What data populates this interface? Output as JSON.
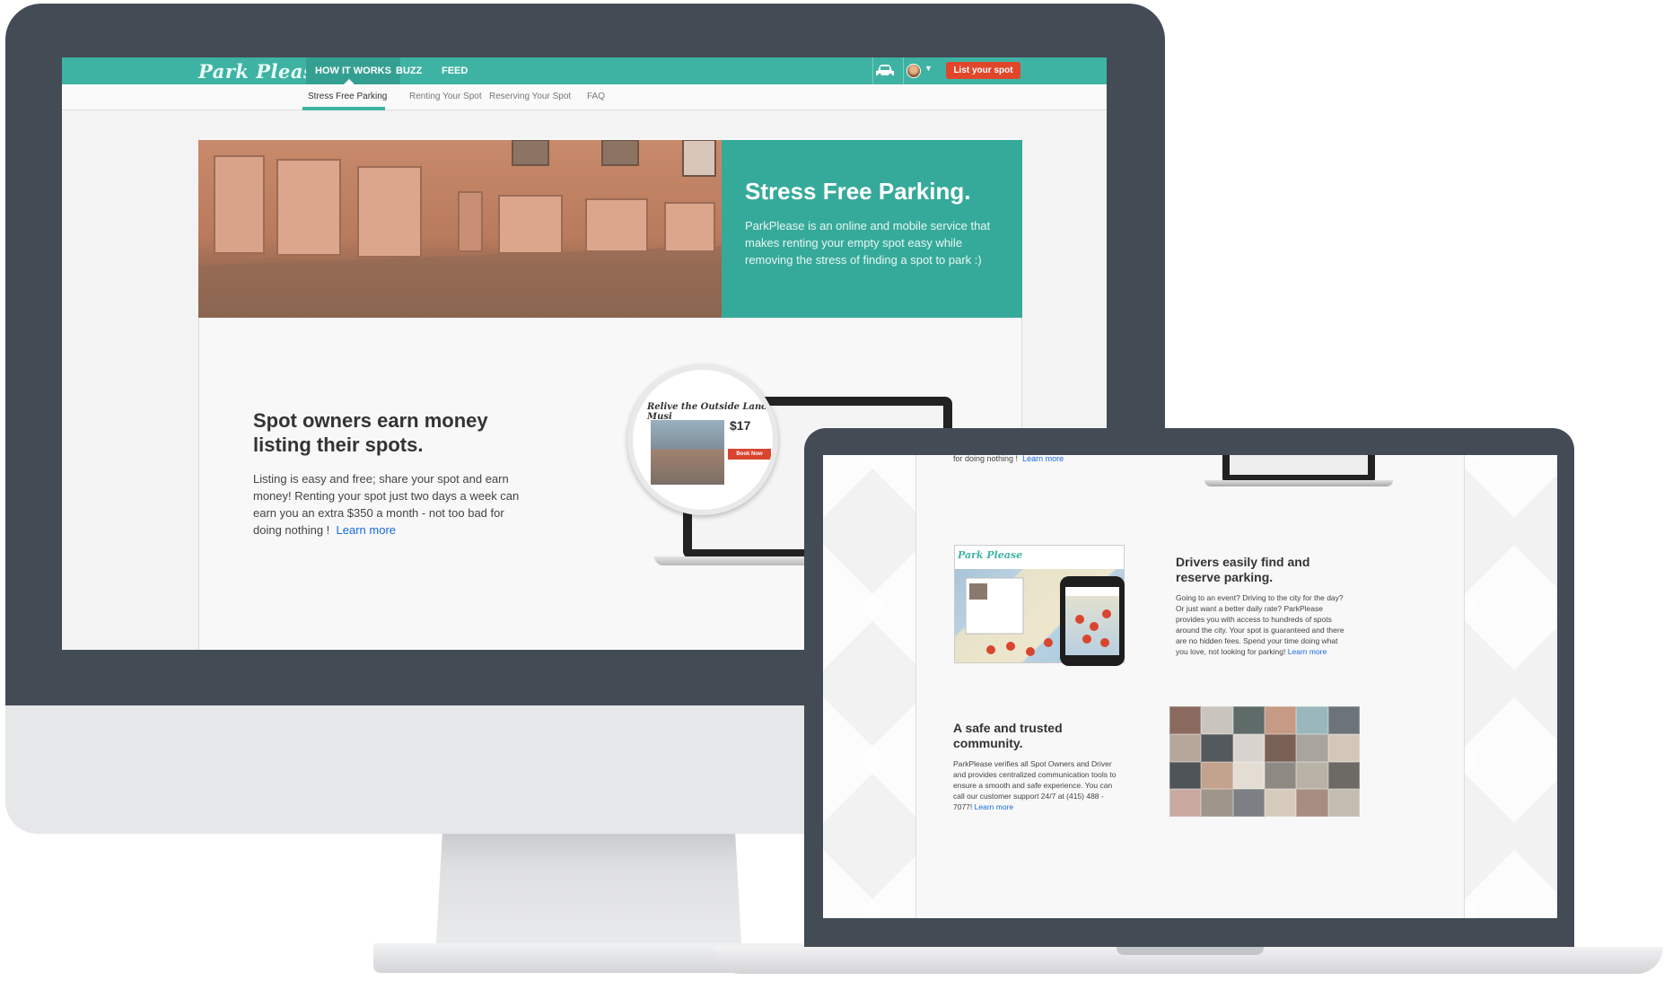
{
  "desktop": {
    "nav": {
      "logo": "Park Please",
      "how_it_works": "HOW IT WORKS",
      "buzz": "BUZZ",
      "feed": "FEED",
      "list_spot": "List your spot",
      "car_icon": "car-icon",
      "avatar_icon": "avatar"
    },
    "sub_nav": {
      "stress_free": "Stress Free Parking",
      "renting": "Renting Your Spot",
      "reserving": "Reserving Your Spot",
      "faq": "FAQ"
    },
    "hero": {
      "title": "Stress Free Parking.",
      "text": "ParkPlease is an online and mobile service that makes renting your empty spot easy while removing the stress of finding a spot to park :)"
    },
    "section1": {
      "title": "Spot owners earn money listing their spots.",
      "text": "Listing is easy and free; share your spot and earn money! Renting your spot just two days a week can earn you an extra $350 a month - not too bad for doing nothing !",
      "link": "Learn more"
    },
    "illustration": {
      "title": "Relive the Outside Lands Musi",
      "price": "$17",
      "book_now": "Book Now"
    }
  },
  "laptop": {
    "top_text": "for doing nothing !",
    "top_link": "Learn more",
    "map_logo": "Park Please",
    "drivers": {
      "title": "Drivers easily find and reserve parking.",
      "text": "Going to an event? Driving to the city for the day? Or just want a better daily rate? ParkPlease provides you with access to hundreds of spots around the city. Your spot is guaranteed and there are no hidden fees. Spend your time doing what you love, not looking for parking!",
      "link": "Learn more"
    },
    "community": {
      "title": "A safe and trusted community.",
      "text": "ParkPlease verifies all Spot Owners and Driver and provides centralized communication tools to ensure a smooth and safe experience. You can call our customer support 24/7 at (415) 488 - 7077!",
      "link": "Learn more"
    }
  },
  "colors": {
    "teal": "#3fb3a3",
    "teal_panel": "#25a391",
    "red_button": "#e2462a",
    "device_frame": "#434b55",
    "link": "#1a6ae0"
  }
}
